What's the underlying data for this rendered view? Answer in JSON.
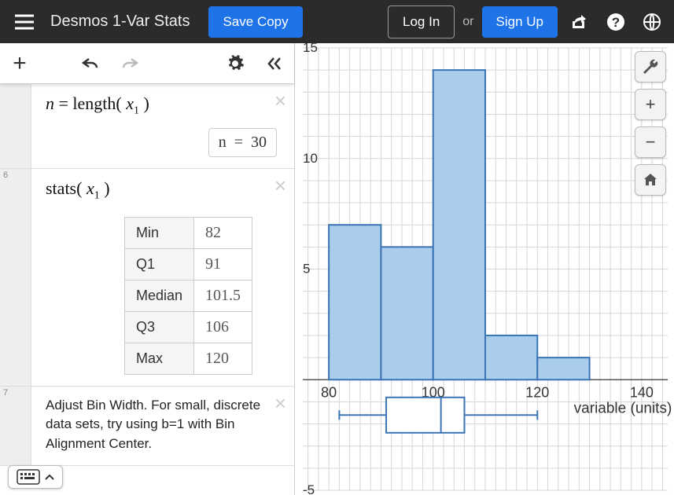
{
  "header": {
    "title": "Desmos 1-Var Stats",
    "save_label": "Save Copy",
    "login_label": "Log In",
    "or_label": "or",
    "signup_label": "Sign Up"
  },
  "panel": {
    "row5_index": "6",
    "row7_index": "7",
    "expr_n": "n = length( x₁ )",
    "n_output_lhs": "n",
    "n_output_eq": "=",
    "n_output_val": "30",
    "expr_stats": "stats( x₁ )",
    "stats": {
      "labels": {
        "min": "Min",
        "q1": "Q1",
        "median": "Median",
        "q3": "Q3",
        "max": "Max"
      },
      "values": {
        "min": "82",
        "q1": "91",
        "median": "101.5",
        "q3": "106",
        "max": "120"
      }
    },
    "note": "Adjust Bin Width.  For small, discrete data sets, try using b=1 with Bin Alignment Center."
  },
  "chart_data": {
    "type": "bar",
    "title": "",
    "xlabel": "variable (units)",
    "ylabel": "",
    "xlim": [
      75,
      145
    ],
    "ylim": [
      -5,
      15
    ],
    "xticks": [
      80,
      100,
      120,
      140
    ],
    "yticks": [
      -5,
      5,
      10,
      15
    ],
    "bin_width": 10,
    "categories": [
      80,
      90,
      100,
      110,
      120
    ],
    "values": [
      7,
      6,
      14,
      2,
      1
    ],
    "boxplot": {
      "min": 82,
      "q1": 91,
      "median": 101.5,
      "q3": 106,
      "max": 120
    },
    "colors": {
      "bar_fill": "#a9cdea",
      "bar_stroke": "#3a74b4",
      "grid": "#d6d6d6",
      "axis": "#555"
    }
  }
}
